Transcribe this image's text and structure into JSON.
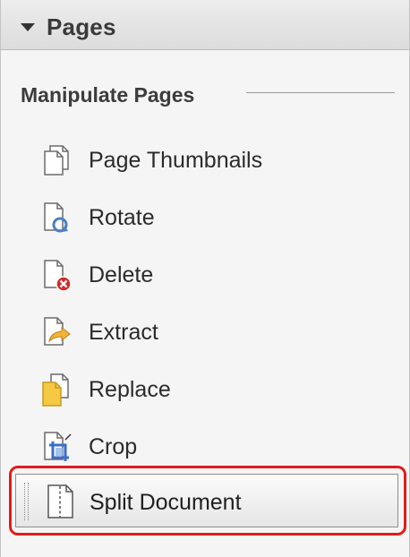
{
  "panel": {
    "title": "Pages",
    "section_title": "Manipulate Pages"
  },
  "items": [
    {
      "label": "Page Thumbnails",
      "icon": "page-thumbnails-icon"
    },
    {
      "label": "Rotate",
      "icon": "rotate-icon"
    },
    {
      "label": "Delete",
      "icon": "delete-icon"
    },
    {
      "label": "Extract",
      "icon": "extract-icon"
    },
    {
      "label": "Replace",
      "icon": "replace-icon"
    },
    {
      "label": "Crop",
      "icon": "crop-icon"
    }
  ],
  "highlighted_item": {
    "label": "Split Document",
    "icon": "split-document-icon"
  },
  "colors": {
    "highlight_border": "#e41b1b",
    "delete_badge": "#d6282a",
    "extract_arrow": "#f2b437",
    "replace_page": "#f6c945",
    "rotate_arrow": "#4a7fc3",
    "crop_frame": "#3b6fc7"
  }
}
